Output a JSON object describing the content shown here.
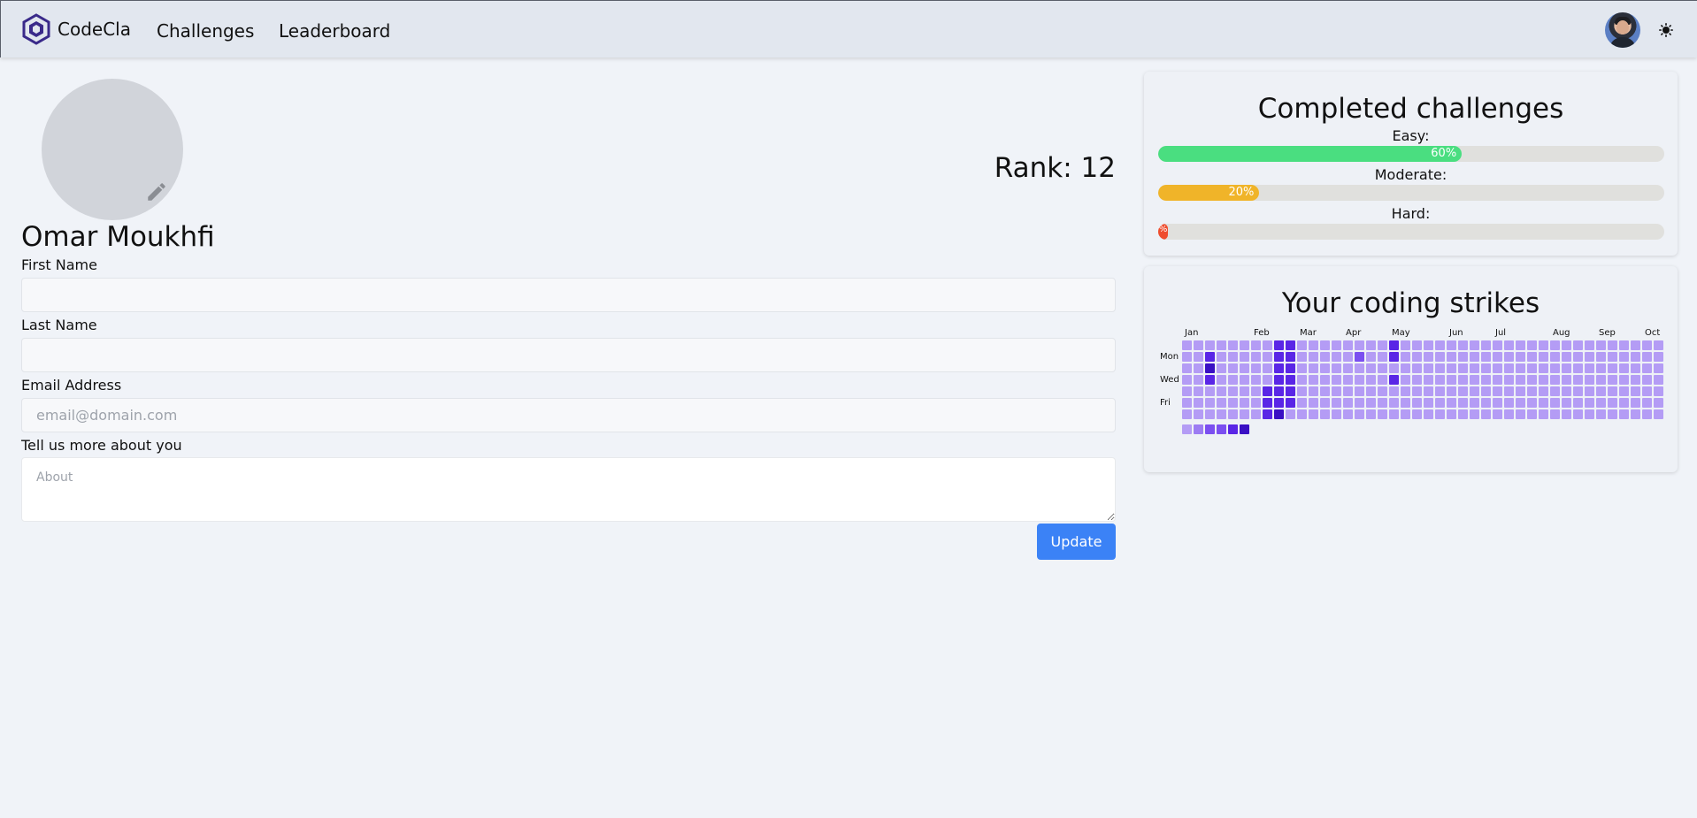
{
  "navbar": {
    "brand_name": "CodeCla",
    "links": [
      "Challenges",
      "Leaderboard"
    ],
    "avatar_icon": "user-avatar",
    "theme_icon": "sun-icon"
  },
  "profile": {
    "name": "Omar Moukhfi",
    "rank_label": "Rank: 12",
    "avatar_icon": "avatar-placeholder",
    "edit_icon": "pencil-icon"
  },
  "form": {
    "first_name_label": "First Name",
    "first_name_value": "",
    "last_name_label": "Last Name",
    "last_name_value": "",
    "email_label": "Email Address",
    "email_placeholder": "email@domain.com",
    "about_label": "Tell us more about you",
    "about_placeholder": "About",
    "update_label": "Update"
  },
  "completed": {
    "title": "Completed challenges",
    "levels": [
      {
        "label": "Easy:",
        "percent": 60,
        "text": "60%",
        "color": "#4ade80"
      },
      {
        "label": "Moderate:",
        "percent": 20,
        "text": "20%",
        "color": "#f0b429"
      },
      {
        "label": "Hard:",
        "percent": 2,
        "text": "%",
        "color": "#ef4d2e"
      }
    ]
  },
  "strikes": {
    "title": "Your coding strikes",
    "months": [
      "Jan",
      "Feb",
      "Mar",
      "Apr",
      "May",
      "Jun",
      "Jul",
      "Aug",
      "Sep",
      "Oct"
    ],
    "days": [
      "Mon",
      "Wed",
      "Fri"
    ],
    "colors": [
      "#b49cf5",
      "#9c7cf2",
      "#7b4ff0",
      "#5a26e6",
      "#3a10c4"
    ],
    "active_cells": [
      {
        "week": 2,
        "day": 1,
        "level": 3
      },
      {
        "week": 2,
        "day": 2,
        "level": 4
      },
      {
        "week": 2,
        "day": 3,
        "level": 3
      },
      {
        "week": 7,
        "day": 4,
        "level": 3
      },
      {
        "week": 7,
        "day": 5,
        "level": 3
      },
      {
        "week": 7,
        "day": 6,
        "level": 3
      },
      {
        "week": 8,
        "day": 0,
        "level": 3
      },
      {
        "week": 8,
        "day": 1,
        "level": 3
      },
      {
        "week": 8,
        "day": 2,
        "level": 3
      },
      {
        "week": 8,
        "day": 3,
        "level": 3
      },
      {
        "week": 8,
        "day": 4,
        "level": 3
      },
      {
        "week": 8,
        "day": 5,
        "level": 3
      },
      {
        "week": 8,
        "day": 6,
        "level": 4
      },
      {
        "week": 9,
        "day": 0,
        "level": 3
      },
      {
        "week": 9,
        "day": 1,
        "level": 3
      },
      {
        "week": 9,
        "day": 2,
        "level": 3
      },
      {
        "week": 9,
        "day": 3,
        "level": 3
      },
      {
        "week": 9,
        "day": 4,
        "level": 3
      },
      {
        "week": 9,
        "day": 5,
        "level": 3
      },
      {
        "week": 15,
        "day": 1,
        "level": 2
      },
      {
        "week": 18,
        "day": 0,
        "level": 3
      },
      {
        "week": 18,
        "day": 1,
        "level": 3
      },
      {
        "week": 18,
        "day": 3,
        "level": 3
      }
    ],
    "legend_levels": [
      0,
      1,
      2,
      2,
      3,
      4
    ]
  }
}
